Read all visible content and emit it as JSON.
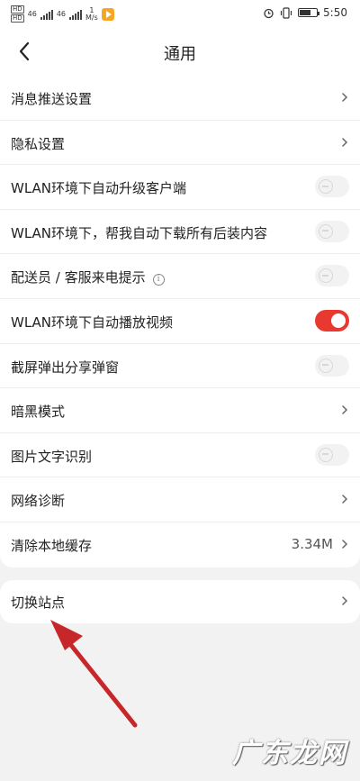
{
  "status_bar": {
    "hd_top": "HD",
    "hd_bottom": "HD",
    "net1": "46",
    "net2": "46",
    "speed_num": "1",
    "speed_unit": "M/s",
    "time": "5:50"
  },
  "header": {
    "title": "通用",
    "back_icon": "chevron-left-icon"
  },
  "settings": {
    "push": "消息推送设置",
    "privacy": "隐私设置",
    "wlan_upgrade": "WLAN环境下自动升级客户端",
    "wlan_download": "WLAN环境下，帮我自动下载所有后装内容",
    "courier_call": "配送员 / 客服来电提示",
    "courier_info": "i",
    "wlan_video": "WLAN环境下自动播放视频",
    "screenshot_share": "截屏弹出分享弹窗",
    "dark_mode": "暗黑模式",
    "ocr": "图片文字识别",
    "network": "网络诊断",
    "cache_label": "清除本地缓存",
    "cache_value": "3.34M"
  },
  "toggles": {
    "wlan_upgrade": false,
    "wlan_download": false,
    "courier_call": false,
    "wlan_video": true,
    "screenshot_share": false,
    "ocr": false
  },
  "switch_site": {
    "label": "切换站点"
  },
  "annotation": {
    "arrow_color": "#c8272a"
  },
  "watermark": "广东龙网",
  "colors": {
    "accent": "#e8382f",
    "background": "#f2f2f2"
  }
}
